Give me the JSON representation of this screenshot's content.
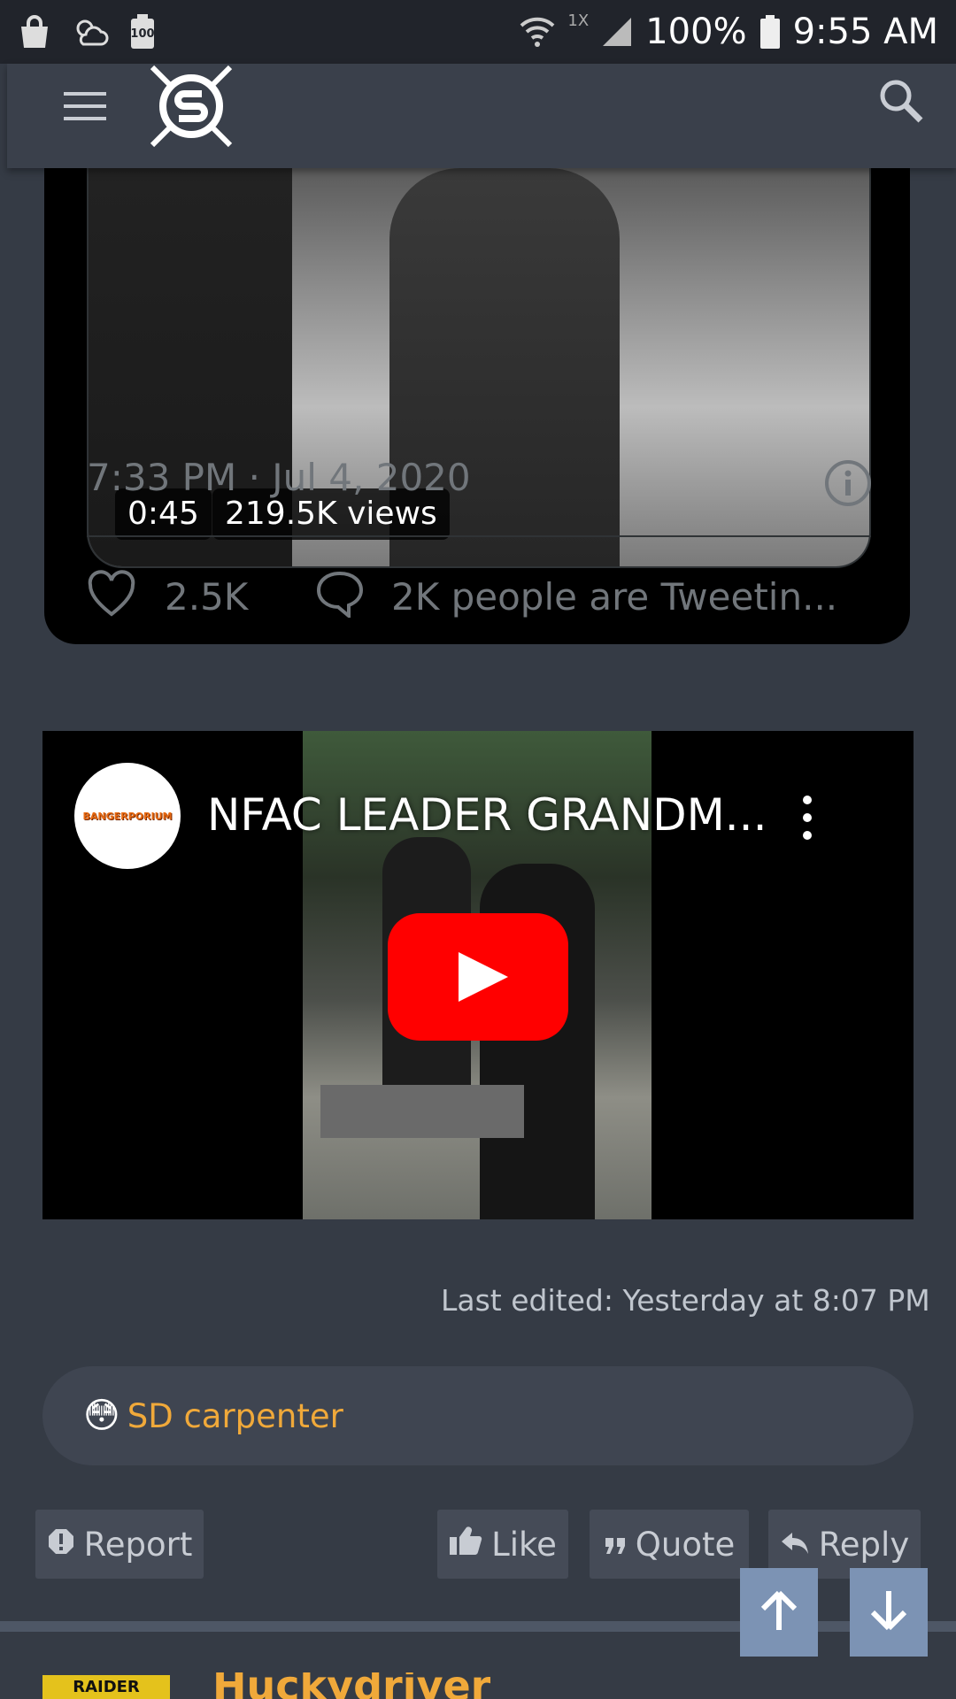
{
  "status_bar": {
    "battery_badge": "100",
    "network_rate": "1X",
    "battery_percent": "100%",
    "time": "9:55 AM"
  },
  "tweet": {
    "duration": "0:45",
    "views": "219.5K views",
    "timestamp": "7:33 PM · Jul 4, 2020",
    "likes": "2.5K",
    "tweeting": "2K people are Tweetin..."
  },
  "youtube": {
    "title": "NFAC LEADER GRANDM...",
    "channel_badge": "BANGERPORIUM"
  },
  "post": {
    "last_edited": "Last edited: Yesterday at 8:07 PM",
    "reaction_emoji": "😳",
    "reaction_user": "SD carpenter"
  },
  "actions": {
    "report": "Report",
    "like": "Like",
    "quote": "Quote",
    "reply": "Reply"
  },
  "next_post": {
    "avatar_text": "RAIDER",
    "username": "Huckydriver"
  },
  "colors": {
    "accent": "#f0a93a",
    "background": "#353b45",
    "header": "#3a404b",
    "scroll_button": "#7c93b4",
    "youtube_red": "#ff0000"
  }
}
